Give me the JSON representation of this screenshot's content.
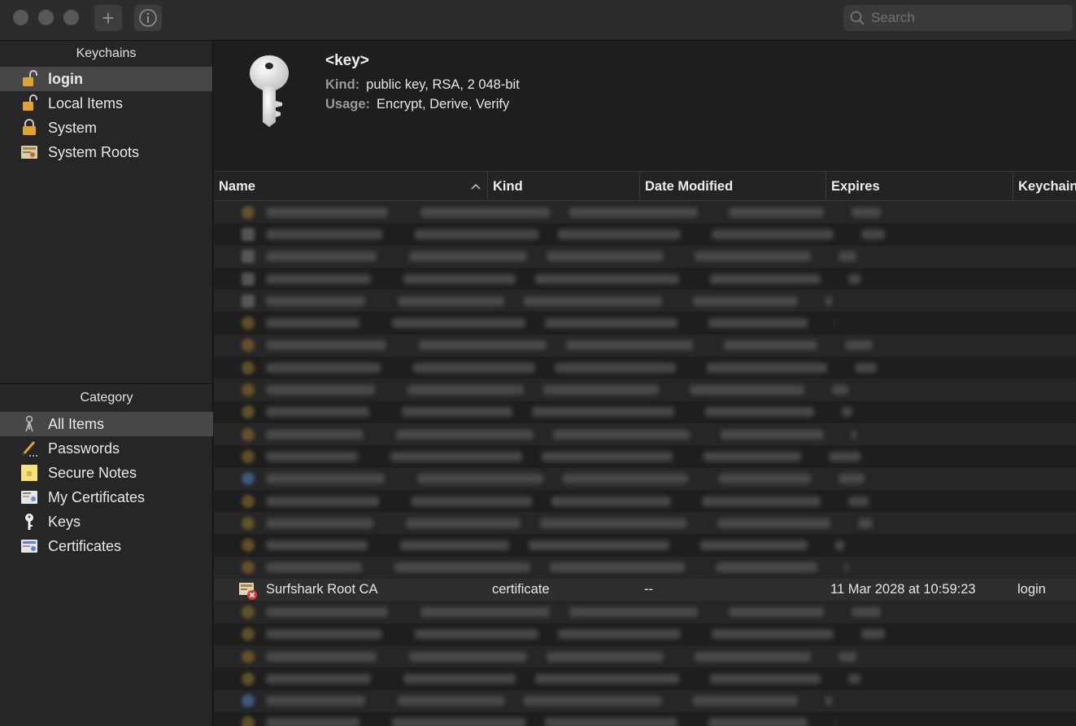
{
  "toolbar": {
    "search_placeholder": "Search"
  },
  "sidebar": {
    "keychains_title": "Keychains",
    "keychains": [
      {
        "label": "login",
        "selected": true,
        "icon": "lock-open-icon"
      },
      {
        "label": "Local Items",
        "selected": false,
        "icon": "lock-open-icon"
      },
      {
        "label": "System",
        "selected": false,
        "icon": "lock-closed-icon"
      },
      {
        "label": "System Roots",
        "selected": false,
        "icon": "certificate-folder-icon"
      }
    ],
    "category_title": "Category",
    "categories": [
      {
        "label": "All Items",
        "selected": true,
        "icon": "all-items-icon"
      },
      {
        "label": "Passwords",
        "selected": false,
        "icon": "pencil-icon"
      },
      {
        "label": "Secure Notes",
        "selected": false,
        "icon": "note-icon"
      },
      {
        "label": "My Certificates",
        "selected": false,
        "icon": "my-certificate-icon"
      },
      {
        "label": "Keys",
        "selected": false,
        "icon": "key-icon"
      },
      {
        "label": "Certificates",
        "selected": false,
        "icon": "certificate-icon"
      }
    ]
  },
  "detail": {
    "name": "<key>",
    "kind_label": "Kind:",
    "kind_value": "public key, RSA, 2 048-bit",
    "usage_label": "Usage:",
    "usage_value": "Encrypt, Derive, Verify"
  },
  "table": {
    "columns": {
      "name": "Name",
      "kind": "Kind",
      "date": "Date Modified",
      "expires": "Expires",
      "keychain": "Keychain"
    },
    "sort_indicator": "^",
    "visible_row": {
      "name": "Surfshark Root CA",
      "kind": "certificate",
      "date": "--",
      "expires": "11 Mar 2028 at 10:59:23",
      "keychain": "login",
      "icon": "invalid-certificate-icon"
    }
  },
  "colors": {
    "window_bg": "#1e1e1e",
    "sidebar_bg": "#262626",
    "selection": "#464646",
    "lock_gold": "#e0a32e"
  }
}
